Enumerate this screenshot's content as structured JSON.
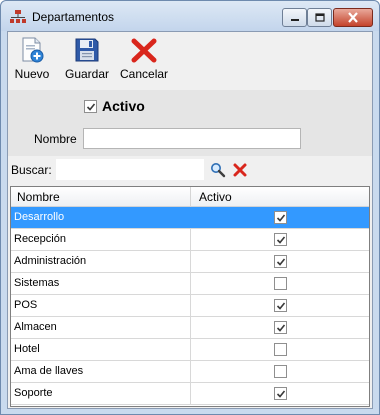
{
  "window": {
    "title": "Departamentos",
    "icon": "network-departments-icon"
  },
  "toolbar": {
    "nuevo_label": "Nuevo",
    "guardar_label": "Guardar",
    "cancelar_label": "Cancelar"
  },
  "form": {
    "activo_label": "Activo",
    "activo_checked": true,
    "nombre_label": "Nombre",
    "nombre_value": ""
  },
  "search": {
    "label": "Buscar:",
    "value": ""
  },
  "grid": {
    "columns": [
      "Nombre",
      "Activo"
    ],
    "rows": [
      {
        "nombre": "Desarrollo",
        "activo": true,
        "selected": true
      },
      {
        "nombre": "Recepción",
        "activo": true
      },
      {
        "nombre": "Administración",
        "activo": true
      },
      {
        "nombre": "Sistemas",
        "activo": false
      },
      {
        "nombre": "POS",
        "activo": true
      },
      {
        "nombre": "Almacen",
        "activo": true
      },
      {
        "nombre": "Hotel",
        "activo": false
      },
      {
        "nombre": "Ama de llaves",
        "activo": false
      },
      {
        "nombre": "Soporte",
        "activo": true
      }
    ]
  },
  "colors": {
    "selection": "#3399ff",
    "cancel_red": "#d9261c"
  }
}
